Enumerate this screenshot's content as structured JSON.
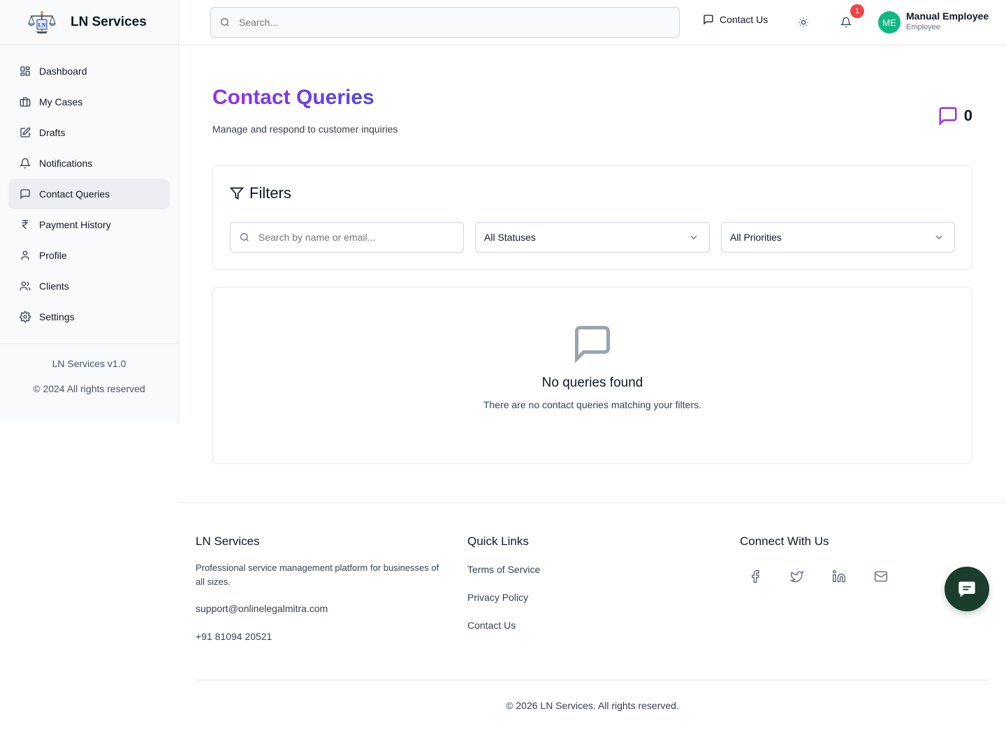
{
  "brand": {
    "name": "LN Services",
    "logo_text": "LN"
  },
  "sidebar": {
    "items": [
      {
        "label": "Dashboard",
        "icon": "dashboard-icon"
      },
      {
        "label": "My Cases",
        "icon": "briefcase-icon"
      },
      {
        "label": "Drafts",
        "icon": "edit-icon"
      },
      {
        "label": "Notifications",
        "icon": "bell-icon"
      },
      {
        "label": "Contact Queries",
        "icon": "message-square-icon",
        "active": true
      },
      {
        "label": "Payment History",
        "icon": "rupee-icon"
      },
      {
        "label": "Profile",
        "icon": "user-icon"
      },
      {
        "label": "Clients",
        "icon": "users-icon"
      },
      {
        "label": "Settings",
        "icon": "gear-icon"
      }
    ],
    "version": "LN Services v1.0",
    "copyright": "© 2024 All rights reserved"
  },
  "topbar": {
    "search_placeholder": "Search...",
    "contact_label": "Contact Us",
    "notification_count": "1",
    "user": {
      "initials": "ME",
      "name": "Manual Employee",
      "role": "Employee"
    }
  },
  "main": {
    "title": "Contact Queries",
    "subtitle": "Manage and respond to customer inquiries",
    "query_count": "0",
    "filters": {
      "heading": "Filters",
      "search_placeholder": "Search by name or email...",
      "status_value": "All Statuses",
      "priority_value": "All Priorities"
    },
    "empty": {
      "title": "No queries found",
      "description": "There are no contact queries matching your filters."
    }
  },
  "footer": {
    "about": {
      "title": "LN Services",
      "description": "Professional service management platform for businesses of all sizes.",
      "email": "support@onlinelegalmitra.com",
      "phone": "+91 81094 20521"
    },
    "quick_links": {
      "title": "Quick Links",
      "links": [
        "Terms of Service",
        "Privacy Policy",
        "Contact Us"
      ]
    },
    "connect": {
      "title": "Connect With Us",
      "icons": [
        "facebook-icon",
        "twitter-icon",
        "linkedin-icon",
        "mail-icon"
      ]
    },
    "copyright": "© 2026 LN Services. All rights reserved."
  },
  "colors": {
    "accent_purple": "#9333ea",
    "accent_indigo": "#4f46e5",
    "avatar_bg": "#10b981",
    "badge_red": "#ef4444",
    "chat_fab": "#1a3d2e"
  }
}
